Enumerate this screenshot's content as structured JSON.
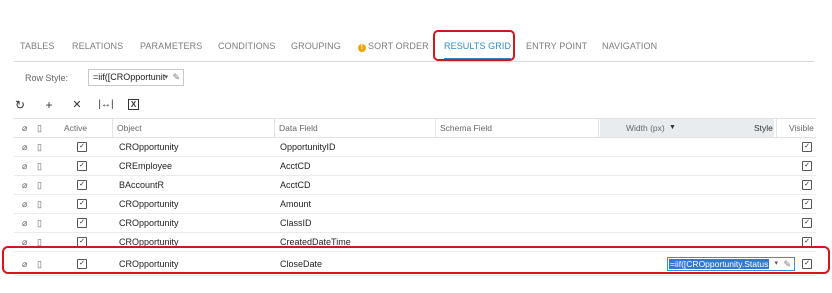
{
  "tabs": [
    "TABLES",
    "RELATIONS",
    "PARAMETERS",
    "CONDITIONS",
    "GROUPING",
    "SORT ORDER",
    "RESULTS GRID",
    "ENTRY POINT",
    "NAVIGATION"
  ],
  "row_style": {
    "label": "Row Style:",
    "value": "=iif([CROpportunit"
  },
  "grid": {
    "columns": {
      "active": "Active",
      "object": "Object",
      "data_field": "Data Field",
      "schema_field": "Schema Field",
      "width": "Width (px)",
      "style": "Style",
      "visible": "Visible"
    },
    "rows": [
      {
        "object": "CROpportunity",
        "data_field": "OpportunityID"
      },
      {
        "object": "CREmployee",
        "data_field": "AcctCD"
      },
      {
        "object": "BAccountR",
        "data_field": "AcctCD"
      },
      {
        "object": "CROpportunity",
        "data_field": "Amount"
      },
      {
        "object": "CROpportunity",
        "data_field": "ClassID"
      },
      {
        "object": "CROpportunity",
        "data_field": "CreatedDateTime"
      },
      {
        "object": "CROpportunity",
        "data_field": "CloseDate",
        "style": "=iif([CROpportunity.Status"
      }
    ]
  },
  "colors": {
    "accent": "#2e8bd1",
    "highlight": "#d6151f",
    "warning": "#f0a500",
    "selection": "#3478d6"
  }
}
